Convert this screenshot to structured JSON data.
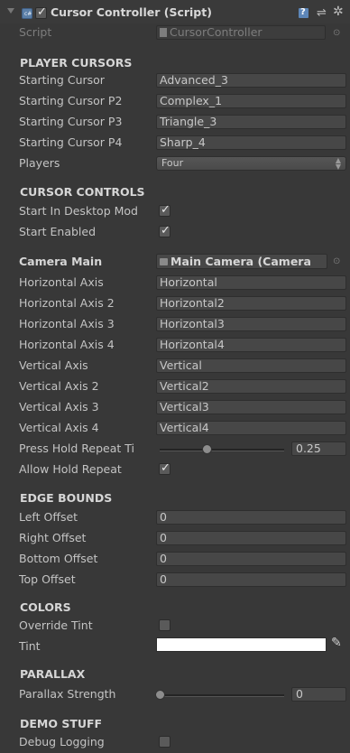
{
  "header": {
    "title": "Cursor Controller (Script)",
    "enabled": true,
    "icons": {
      "script": "cs-script-icon",
      "help": "help-book-icon",
      "presets": "sliders-icon",
      "settings": "gear-icon"
    }
  },
  "script_row": {
    "label": "Script",
    "value": "CursorController"
  },
  "player_cursors": {
    "heading": "PLAYER CURSORS",
    "rows": [
      {
        "label": "Starting Cursor",
        "value": "Advanced_3"
      },
      {
        "label": "Starting Cursor P2",
        "value": "Complex_1"
      },
      {
        "label": "Starting Cursor P3",
        "value": "Triangle_3"
      },
      {
        "label": "Starting Cursor P4",
        "value": "Sharp_4"
      }
    ],
    "players": {
      "label": "Players",
      "value": "Four"
    }
  },
  "cursor_controls": {
    "heading": "CURSOR CONTROLS",
    "start_in_desktop": {
      "label": "Start In Desktop Mod",
      "checked": true
    },
    "start_enabled": {
      "label": "Start Enabled",
      "checked": true
    },
    "camera_main": {
      "label": "Camera Main",
      "value": "Main Camera (Camera"
    },
    "axes": [
      {
        "label": "Horizontal Axis",
        "value": "Horizontal"
      },
      {
        "label": "Horizontal Axis 2",
        "value": "Horizontal2"
      },
      {
        "label": "Horizontal Axis 3",
        "value": "Horizontal3"
      },
      {
        "label": "Horizontal Axis 4",
        "value": "Horizontal4"
      },
      {
        "label": "Vertical Axis",
        "value": "Vertical"
      },
      {
        "label": "Vertical Axis 2",
        "value": "Vertical2"
      },
      {
        "label": "Vertical Axis 3",
        "value": "Vertical3"
      },
      {
        "label": "Vertical Axis 4",
        "value": "Vertical4"
      }
    ],
    "press_hold": {
      "label": "Press Hold Repeat Ti",
      "value": "0.25",
      "fraction": 0.38
    },
    "allow_hold": {
      "label": "Allow Hold Repeat",
      "checked": true
    }
  },
  "edge_bounds": {
    "heading": "EDGE BOUNDS",
    "rows": [
      {
        "label": "Left Offset",
        "value": "0"
      },
      {
        "label": "Right Offset",
        "value": "0"
      },
      {
        "label": "Bottom Offset",
        "value": "0"
      },
      {
        "label": "Top Offset",
        "value": "0"
      }
    ]
  },
  "colors": {
    "heading": "COLORS",
    "override_tint": {
      "label": "Override Tint",
      "checked": false
    },
    "tint": {
      "label": "Tint",
      "color": "#ffffff"
    }
  },
  "parallax": {
    "heading": "PARALLAX",
    "strength": {
      "label": "Parallax Strength",
      "value": "0",
      "fraction": 0.0
    }
  },
  "demo": {
    "heading": "DEMO STUFF",
    "debug_logging": {
      "label": "Debug Logging",
      "checked": false
    }
  },
  "colors_theme": {
    "panel": "#383838",
    "field": "#474747",
    "text": "#c4c4c4"
  }
}
